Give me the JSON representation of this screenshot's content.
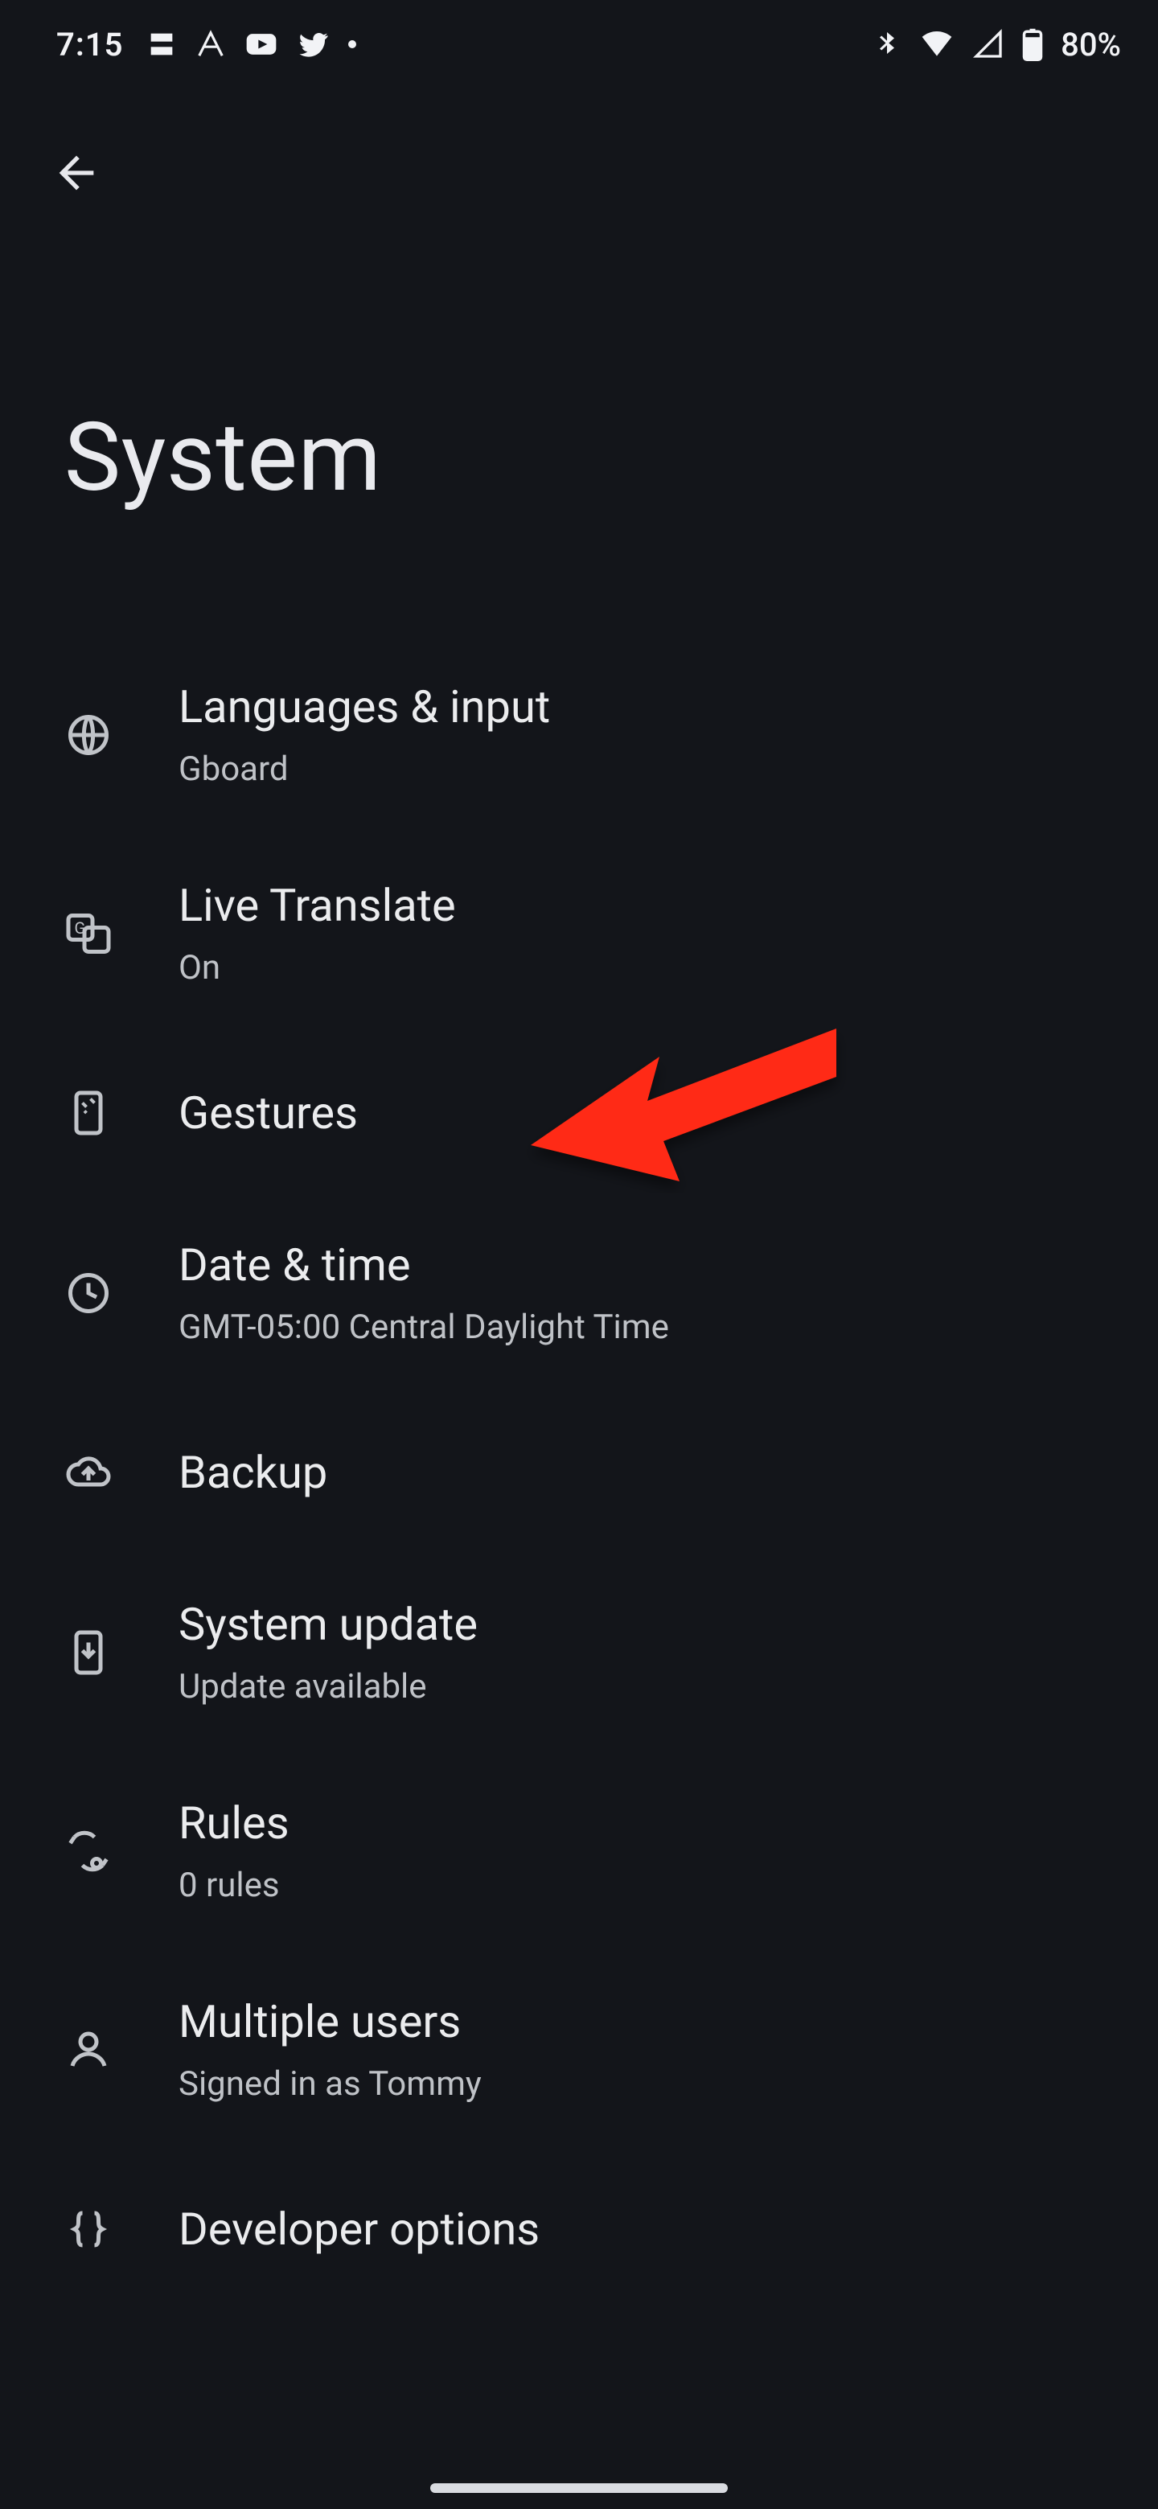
{
  "statusbar": {
    "time": "7:15",
    "battery_pct": "80%",
    "left_icons": [
      "app-e-icon",
      "app-a-icon",
      "youtube-icon",
      "twitter-icon",
      "more-dot-icon"
    ],
    "right_icons": [
      "bluetooth-icon",
      "wifi-icon",
      "cell-signal-icon",
      "battery-icon"
    ]
  },
  "header": {
    "back_label": "Back"
  },
  "page": {
    "title": "System"
  },
  "items": {
    "languages": {
      "title": "Languages & input",
      "sub": "Gboard"
    },
    "translate": {
      "title": "Live Translate",
      "sub": "On"
    },
    "gestures": {
      "title": "Gestures"
    },
    "datetime": {
      "title": "Date & time",
      "sub": "GMT-05:00 Central Daylight Time"
    },
    "backup": {
      "title": "Backup"
    },
    "update": {
      "title": "System update",
      "sub": "Update available"
    },
    "rules": {
      "title": "Rules",
      "sub": "0 rules"
    },
    "users": {
      "title": "Multiple users",
      "sub": "Signed in as Tommy"
    },
    "devopts": {
      "title": "Developer options"
    }
  },
  "annotation": {
    "pointer_target": "gestures"
  }
}
